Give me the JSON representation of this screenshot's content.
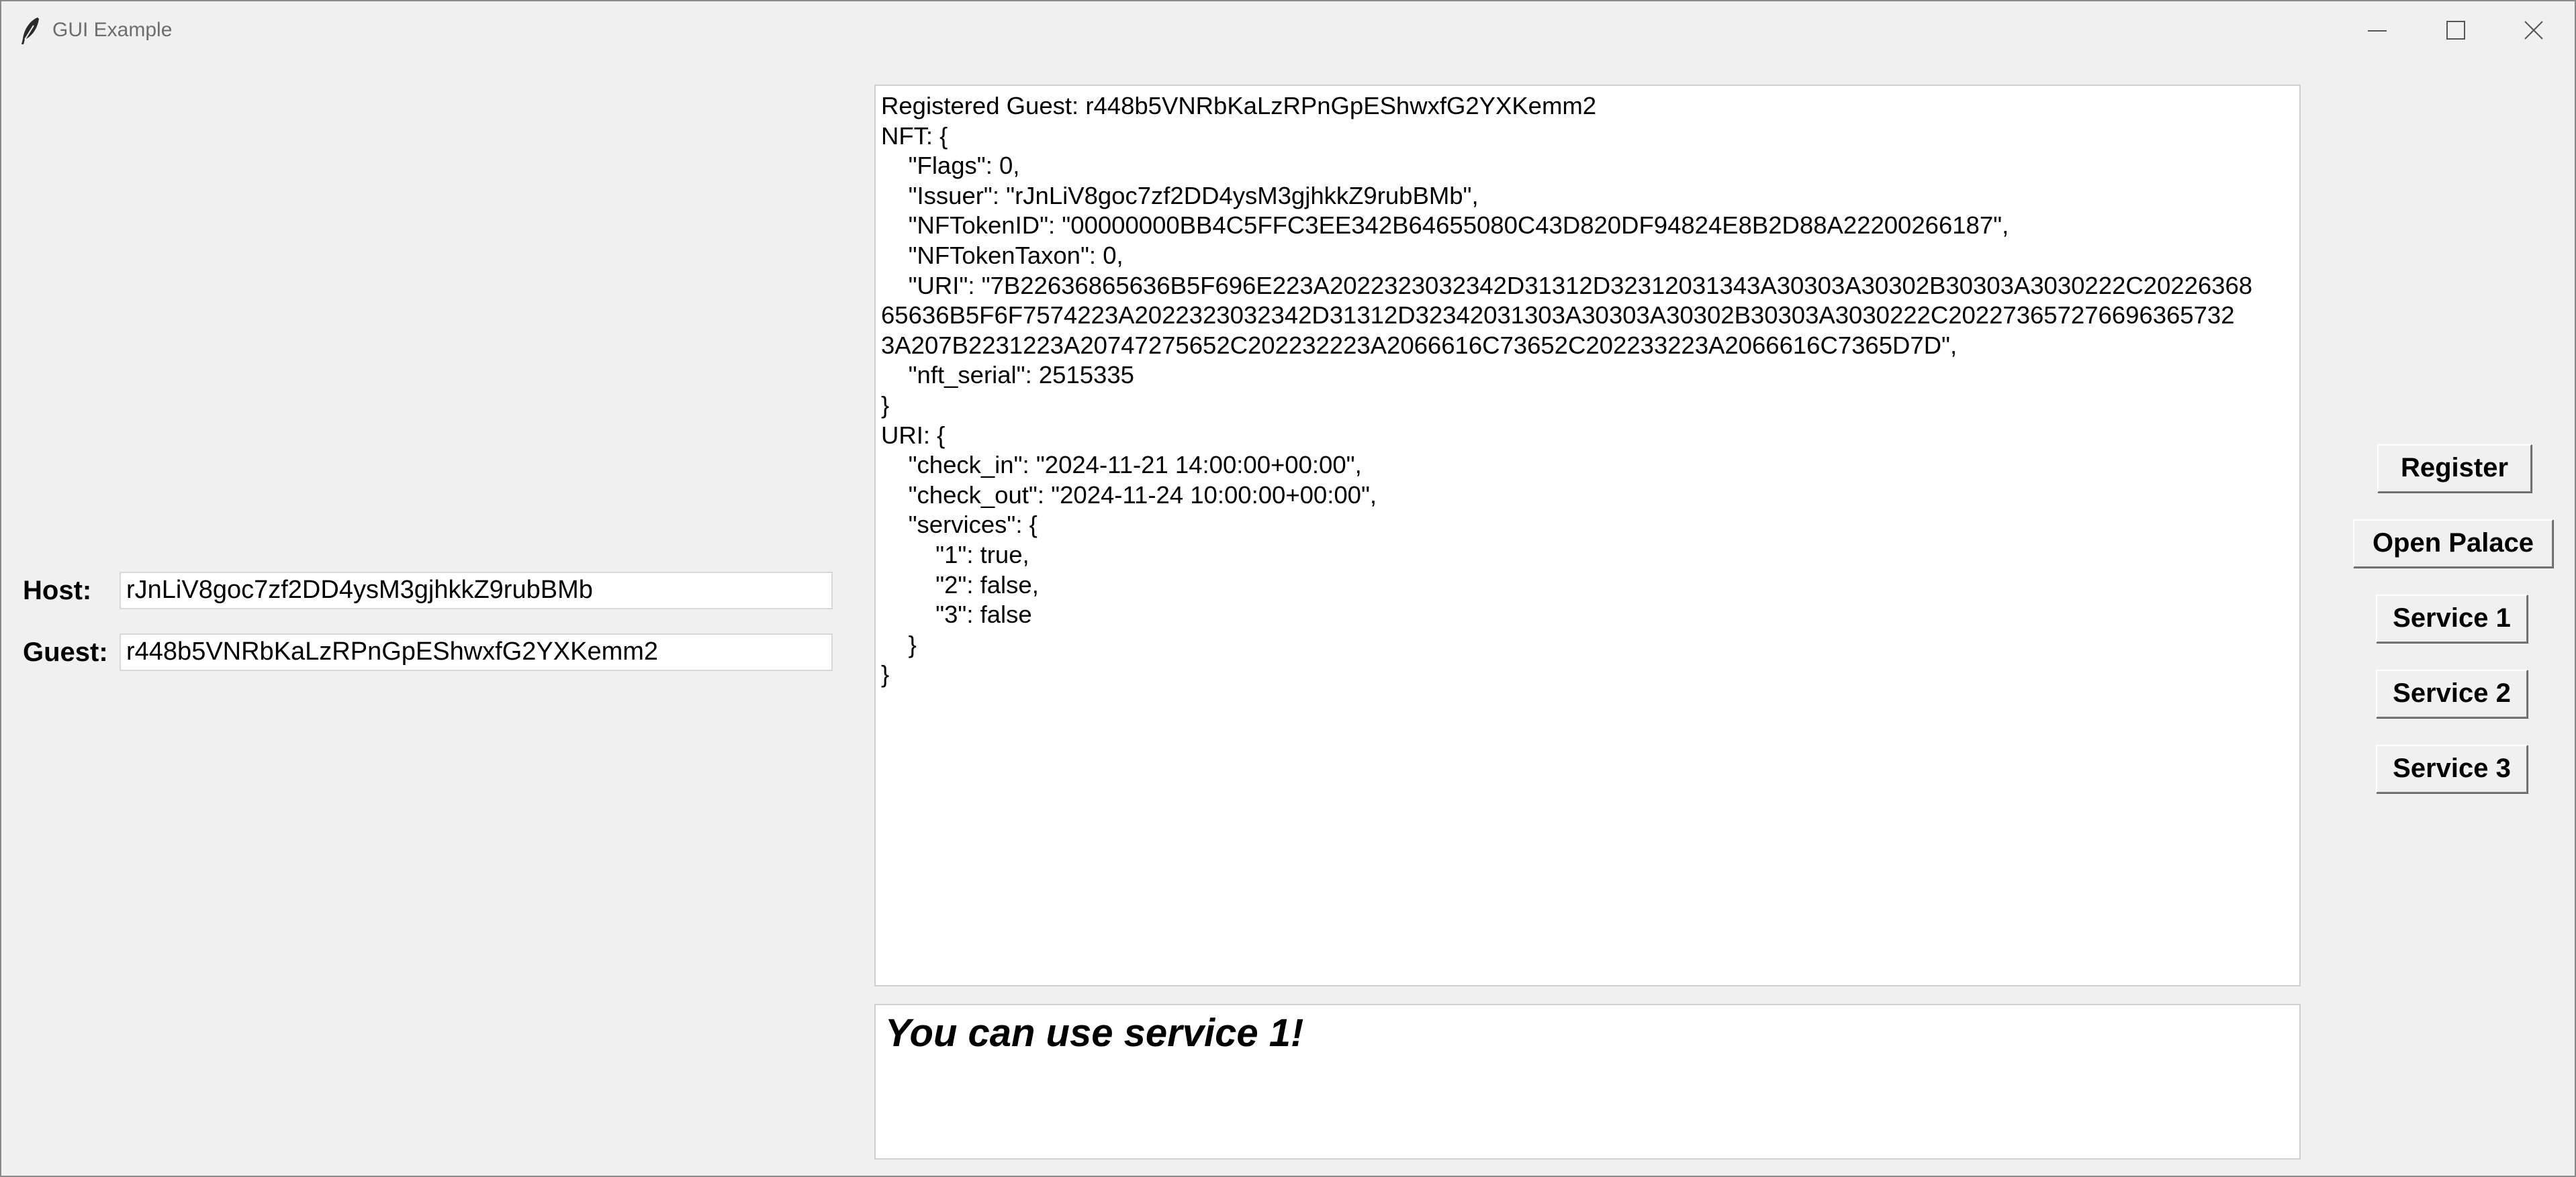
{
  "window": {
    "title": "GUI Example"
  },
  "form": {
    "host_label": "Host:",
    "host_value": "rJnLiV8goc7zf2DD4ysM3gjhkkZ9rubBMb",
    "guest_label": "Guest:",
    "guest_value": "r448b5VNRbKaLzRPnGpEShwxfG2YXKemm2"
  },
  "output": {
    "text": "Registered Guest: r448b5VNRbKaLzRPnGpEShwxfG2YXKemm2\nNFT: {\n    \"Flags\": 0,\n    \"Issuer\": \"rJnLiV8goc7zf2DD4ysM3gjhkkZ9rubBMb\",\n    \"NFTokenID\": \"00000000BB4C5FFC3EE342B64655080C43D820DF94824E8B2D88A22200266187\",\n    \"NFTokenTaxon\": 0,\n    \"URI\": \"7B22636865636B5F696E223A2022323032342D31312D32312031343A30303A30302B30303A3030222C20226368\n65636B5F6F7574223A2022323032342D31312D32342031303A30303A30302B30303A3030222C202273657276696365732\n3A207B2231223A20747275652C202232223A2066616C73652C202233223A2066616C7365D7D\",\n    \"nft_serial\": 2515335\n}\nURI: {\n    \"check_in\": \"2024-11-21 14:00:00+00:00\",\n    \"check_out\": \"2024-11-24 10:00:00+00:00\",\n    \"services\": {\n        \"1\": true,\n        \"2\": false,\n        \"3\": false\n    }\n}"
  },
  "message": {
    "text": "You can use service 1!"
  },
  "buttons": {
    "register": "Register",
    "open_palace": "Open Palace",
    "service_1": "Service 1",
    "service_2": "Service 2",
    "service_3": "Service 3"
  },
  "icons": {
    "app": "feather-icon",
    "minimize": "minimize-icon",
    "maximize": "maximize-icon",
    "close": "close-icon"
  }
}
